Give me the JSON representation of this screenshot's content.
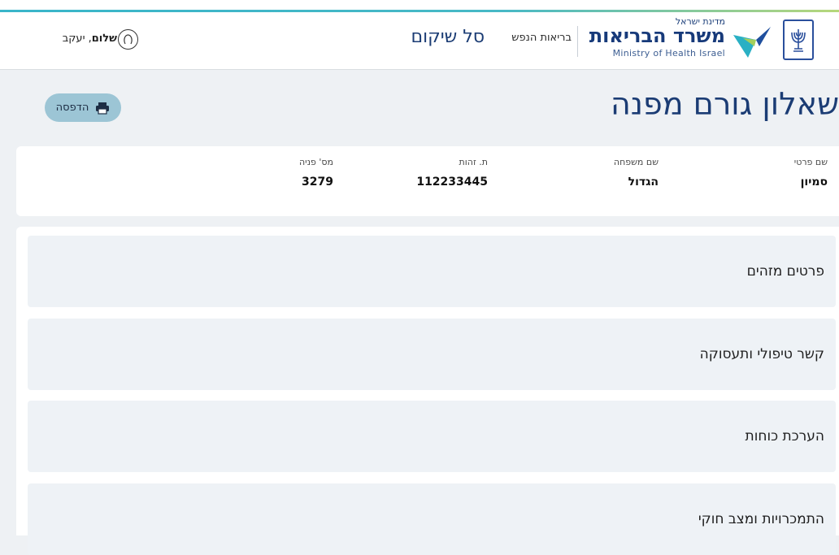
{
  "header": {
    "state_label": "מדינת ישראל",
    "ministry_name": "משרד הבריאות",
    "ministry_english": "Ministry of Health Israel",
    "department": "בריאות הנפש",
    "app_title": "סל שיקום",
    "greeting_bold": "שלום",
    "greeting_name": ", יעקב",
    "accent_color": "#39b5c9",
    "brand_color": "#173a7a",
    "icons": {
      "emblem": "menorah-emblem-icon",
      "logo": "bird-logo-icon",
      "user": "user-avatar-icon"
    }
  },
  "page": {
    "title": "שאלון גורם מפנה",
    "print_label": "הדפסה",
    "print_icon": "printer-icon",
    "print_button_color": "#9cc5d5"
  },
  "person": {
    "fields": [
      {
        "label": "שם פרטי",
        "value": "סמיון"
      },
      {
        "label": "שם משפחה",
        "value": "הגדול"
      },
      {
        "label": "ת. זהות",
        "value": "112233445"
      },
      {
        "label": "מס' פניה",
        "value": "3279"
      }
    ]
  },
  "sections": [
    {
      "label": "פרטים מזהים"
    },
    {
      "label": "קשר טיפולי ותעסוקה"
    },
    {
      "label": "הערכת כוחות"
    },
    {
      "label": "התמכרויות ומצב חוקי"
    }
  ]
}
